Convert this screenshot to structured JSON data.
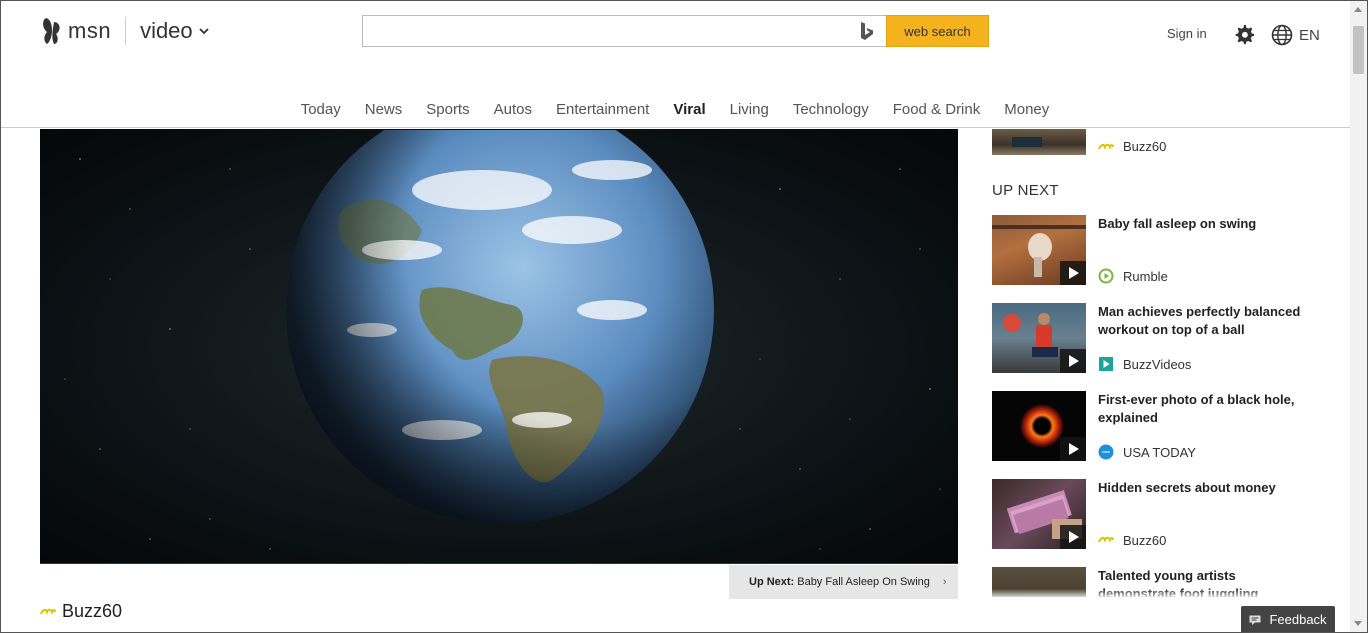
{
  "brand": {
    "name": "msn",
    "section": "video",
    "icon": "msn-butterfly-icon"
  },
  "search": {
    "placeholder": "",
    "value": "",
    "button_label": "web search",
    "accent": "#f4b31e",
    "provider_icon": "bing-icon"
  },
  "header": {
    "signin_label": "Sign in",
    "settings_icon": "gear-icon",
    "language_icon": "globe-icon",
    "language": "EN"
  },
  "nav": {
    "items": [
      {
        "label": "Today",
        "active": false
      },
      {
        "label": "News",
        "active": false
      },
      {
        "label": "Sports",
        "active": false
      },
      {
        "label": "Autos",
        "active": false
      },
      {
        "label": "Entertainment",
        "active": false
      },
      {
        "label": "Viral",
        "active": true
      },
      {
        "label": "Living",
        "active": false
      },
      {
        "label": "Technology",
        "active": false
      },
      {
        "label": "Food & Drink",
        "active": false
      },
      {
        "label": "Money",
        "active": false
      }
    ]
  },
  "player": {
    "up_next_label": "Up Next:",
    "up_next_title": "Baby Fall Asleep On Swing",
    "provider": "Buzz60"
  },
  "sidebar": {
    "top_source": "Buzz60",
    "heading": "UP NEXT",
    "cards": [
      {
        "title": "Baby fall asleep on swing",
        "source": "Rumble",
        "source_icon": "rumble-icon"
      },
      {
        "title": "Man achieves perfectly balanced workout on top of a ball",
        "source": "BuzzVideos",
        "source_icon": "buzzvideos-icon"
      },
      {
        "title": "First-ever photo of a black hole, explained",
        "source": "USA TODAY",
        "source_icon": "usatoday-icon"
      },
      {
        "title": "Hidden secrets about money",
        "source": "Buzz60",
        "source_icon": "buzz60-icon"
      },
      {
        "title": "Talented young artists demonstrate foot juggling",
        "source": "",
        "source_icon": ""
      }
    ]
  },
  "feedback": {
    "label": "Feedback"
  }
}
